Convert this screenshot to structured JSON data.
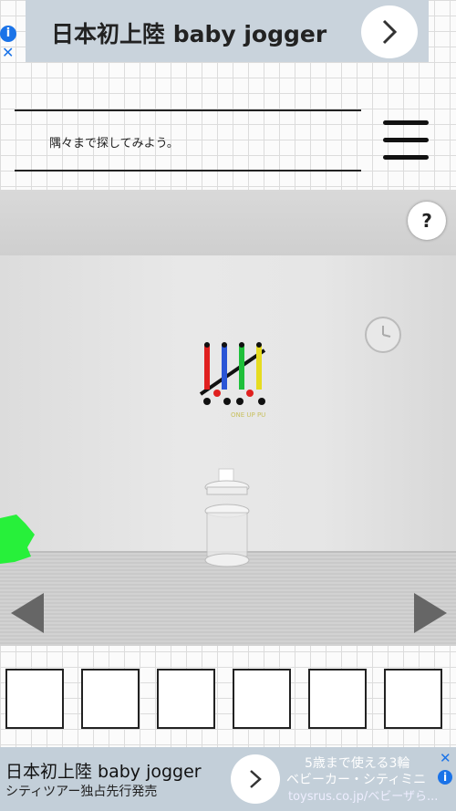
{
  "top_ad": {
    "title": "日本初上陸 baby jogger",
    "info": "i",
    "close": "✕"
  },
  "hint": {
    "text": "隅々まで探してみよう。"
  },
  "scene": {
    "help": "?",
    "shelf_label": "ONE UP PU",
    "sliders": [
      {
        "color": "#e0201f",
        "knob": "#111"
      },
      {
        "color": "#2a55d6",
        "knob": "#e0201f"
      },
      {
        "color": "#1fbf3a",
        "knob": "#111"
      },
      {
        "color": "#e6dc20",
        "knob": "#e0201f"
      }
    ]
  },
  "inventory": {
    "slots": [
      "",
      "",
      "",
      "",
      "",
      ""
    ]
  },
  "bottom_ad": {
    "title": "日本初上陸 baby jogger",
    "subtitle": "シティツアー独占先行発売",
    "right_line1": "5歳まで使える3輪",
    "right_line2": "ベビーカー・シティミニ",
    "right_line3": "toysrus.co.jp/ベビーザら...",
    "info": "i",
    "close": "✕"
  }
}
